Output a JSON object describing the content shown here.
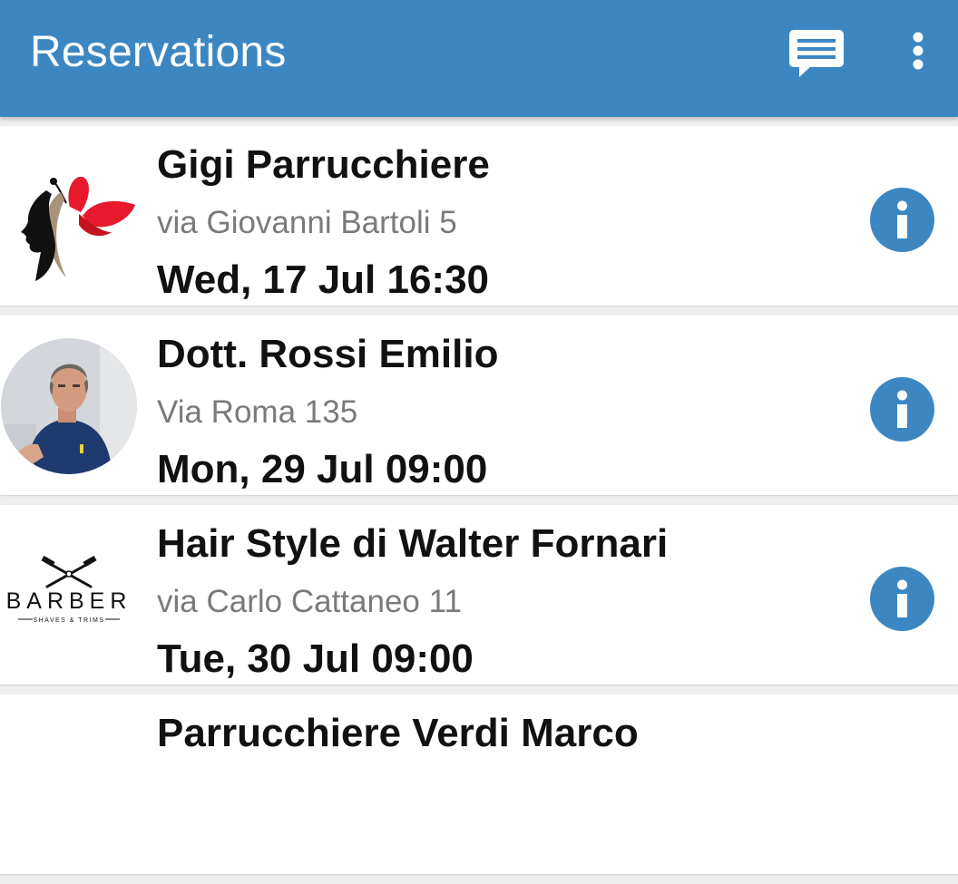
{
  "appbar": {
    "title": "Reservations",
    "chat_icon": "chat-message-icon",
    "more_icon": "more-vert-icon",
    "color": "#3c87c2"
  },
  "reservations": [
    {
      "name": "Gigi Parrucchiere",
      "address": "via Giovanni Bartoli 5",
      "datetime": "Wed, 17 Jul 16:30",
      "avatar": "butterfly-woman-logo"
    },
    {
      "name": "Dott. Rossi Emilio",
      "address": "Via Roma 135",
      "datetime": "Mon, 29 Jul 09:00",
      "avatar": "doctor-photo"
    },
    {
      "name": "Hair Style di Walter Fornari",
      "address": "via Carlo Cattaneo 11",
      "datetime": "Tue, 30 Jul 09:00",
      "avatar": "barber-logo",
      "logo_text": "BARBER",
      "logo_subtext": "SHAVES & TRIMS"
    },
    {
      "name": "Parrucchiere Verdi Marco"
    }
  ]
}
